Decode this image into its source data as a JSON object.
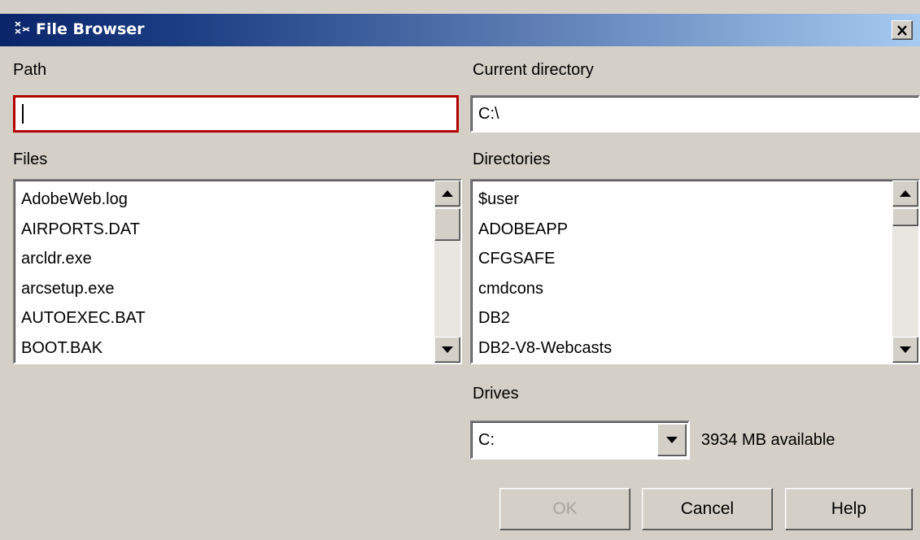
{
  "window": {
    "title": "File Browser",
    "close_icon": "close-x-icon",
    "app_icon": "java-duke-icon"
  },
  "labels": {
    "path": "Path",
    "current_directory": "Current directory",
    "files": "Files",
    "directories": "Directories",
    "drives": "Drives"
  },
  "path_input": {
    "value": ""
  },
  "current_directory": {
    "value": "C:\\"
  },
  "files": [
    "AdobeWeb.log",
    "AIRPORTS.DAT",
    "arcldr.exe",
    "arcsetup.exe",
    "AUTOEXEC.BAT",
    "BOOT.BAK"
  ],
  "directories": [
    "$user",
    "ADOBEAPP",
    "CFGSAFE",
    "cmdcons",
    "DB2",
    "DB2-V8-Webcasts"
  ],
  "drives": {
    "selected": "C:",
    "available_text": "3934 MB available"
  },
  "buttons": {
    "ok": "OK",
    "cancel": "Cancel",
    "help": "Help"
  },
  "colors": {
    "title_start": "#0a246a",
    "title_end": "#a6caf0",
    "focus_border": "#b30000",
    "dialog_bg": "#d4d0c8",
    "disabled_text": "#a8a59e"
  }
}
